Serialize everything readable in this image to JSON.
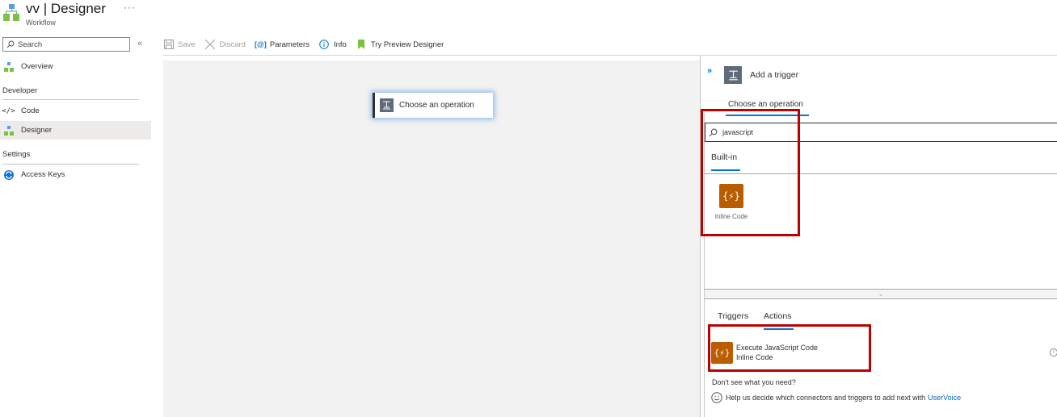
{
  "header": {
    "title": "vv | Designer",
    "subtitle": "Workflow",
    "more_label": "···"
  },
  "sidebar": {
    "search_placeholder": "Search",
    "collapse_label": "«",
    "items": [
      {
        "label": "Overview",
        "icon": "workflow-icon"
      },
      {
        "section": "Developer"
      },
      {
        "label": "Code",
        "icon": "code-icon"
      },
      {
        "label": "Designer",
        "icon": "workflow-icon",
        "active": true
      },
      {
        "section": "Settings"
      },
      {
        "label": "Access Keys",
        "icon": "keys-icon"
      }
    ],
    "overview_label": "Overview",
    "developer_section": "Developer",
    "code_label": "Code",
    "designer_label": "Designer",
    "settings_section": "Settings",
    "access_keys_label": "Access Keys"
  },
  "toolbar": {
    "save_label": "Save",
    "discard_label": "Discard",
    "parameters_label": "Parameters",
    "info_label": "Info",
    "preview_label": "Try Preview Designer"
  },
  "canvas": {
    "operation_card_label": "Choose an operation"
  },
  "panel": {
    "expand_label": "»",
    "title": "Add a trigger",
    "tab_label": "Choose an operation",
    "search_value": "javascript",
    "builtin_tab": "Built-in",
    "connector_label": "Inline Code",
    "connector_glyph": "{⚡}",
    "action_tabs": [
      "Triggers",
      "Actions"
    ],
    "triggers_tab": "Triggers",
    "actions_tab": "Actions",
    "action": {
      "title": "Execute JavaScript Code",
      "subtitle": "Inline Code"
    },
    "info_glyph": "i",
    "dont_see": "Don't see what you need?",
    "feedback_text": "Help us decide which connectors and triggers to add next with",
    "feedback_link": "UserVoice"
  },
  "colors": {
    "accent": "#0078d4",
    "code_icon_bg": "#ba5c00",
    "highlight_red": "#c00000",
    "canvas_bg": "#f2f2f2"
  }
}
